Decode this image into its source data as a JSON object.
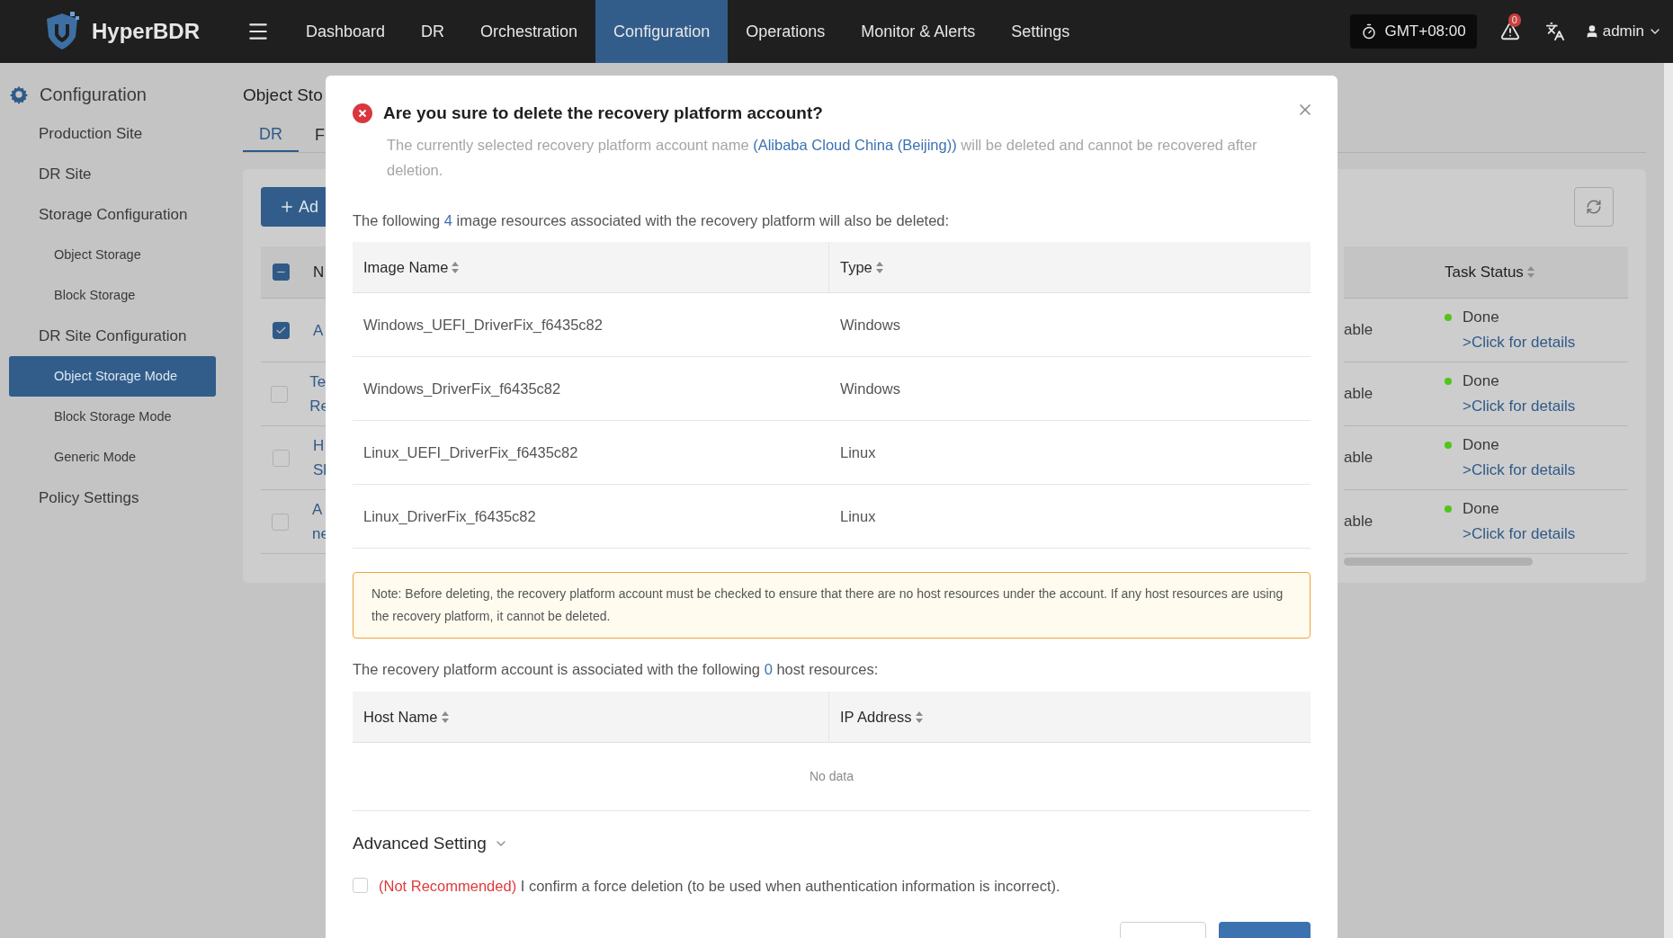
{
  "app": {
    "name": "HyperBDR"
  },
  "nav": [
    {
      "label": "Dashboard",
      "selected": false
    },
    {
      "label": "DR",
      "selected": false
    },
    {
      "label": "Orchestration",
      "selected": false
    },
    {
      "label": "Configuration",
      "selected": true
    },
    {
      "label": "Operations",
      "selected": false
    },
    {
      "label": "Monitor & Alerts",
      "selected": false
    },
    {
      "label": "Settings",
      "selected": false
    }
  ],
  "header": {
    "timezone": "GMT+08:00",
    "alert_count": "0",
    "user": "admin"
  },
  "sidebar": {
    "title": "Configuration",
    "items": [
      {
        "label": "Production Site",
        "selected": false
      },
      {
        "label": "DR Site",
        "selected": false
      },
      {
        "label": "Storage Configuration",
        "selected": false,
        "children": [
          {
            "label": "Object Storage",
            "selected": false
          },
          {
            "label": "Block Storage",
            "selected": false
          }
        ]
      },
      {
        "label": "DR Site Configuration",
        "selected": false,
        "children": [
          {
            "label": "Object Storage Mode",
            "selected": true
          },
          {
            "label": "Block Storage Mode",
            "selected": false
          },
          {
            "label": "Generic Mode",
            "selected": false
          }
        ]
      },
      {
        "label": "Policy Settings",
        "selected": false
      }
    ]
  },
  "page": {
    "title": "Object Sto",
    "tabs": [
      {
        "label": "DR",
        "selected": true
      },
      {
        "label": "F",
        "selected": false
      }
    ],
    "add_button": "Ad",
    "table": {
      "select_all_indeterminate": true,
      "columns": [
        "N",
        "Task Status"
      ],
      "rows": [
        {
          "checked": true,
          "name_lines": [
            "A"
          ],
          "column_cut": "able",
          "status": "Done",
          "color": "#52c41a",
          "details": ">Click for details"
        },
        {
          "checked": false,
          "name_lines": [
            "Te",
            "Re"
          ],
          "column_cut": "able",
          "status": "Done",
          "color": "#52c41a",
          "details": ">Click for details"
        },
        {
          "checked": false,
          "name_lines": [
            "H",
            "Sl"
          ],
          "column_cut": "able",
          "status": "Done",
          "color": "#52c41a",
          "details": ">Click for details"
        },
        {
          "checked": false,
          "name_lines": [
            "A",
            "ne"
          ],
          "column_cut": "able",
          "status": "Done",
          "color": "#52c41a",
          "details": ">Click for details"
        }
      ]
    }
  },
  "modal": {
    "title": "Are you sure to delete the recovery platform account?",
    "description_before": "The currently selected recovery platform account name ",
    "description_link": "(Alibaba Cloud China (Beijing))",
    "description_after": " will be deleted and cannot be recovered after deletion.",
    "images_before": "The following ",
    "images_count": "4",
    "images_after": " image resources associated with the recovery platform will also be deleted:",
    "image_columns": [
      "Image Name",
      "Type"
    ],
    "image_rows": [
      [
        "Windows_UEFI_DriverFix_f6435c82",
        "Windows"
      ],
      [
        "Windows_DriverFix_f6435c82",
        "Windows"
      ],
      [
        "Linux_UEFI_DriverFix_f6435c82",
        "Linux"
      ],
      [
        "Linux_DriverFix_f6435c82",
        "Linux"
      ]
    ],
    "note": "Note: Before deleting, the recovery platform account must be checked to ensure that there are no host resources under the account. If any host resources are using the recovery platform, it cannot be deleted.",
    "hosts_before": "The recovery platform account is associated with the following ",
    "hosts_count": "0",
    "hosts_after": " host resources:",
    "host_columns": [
      "Host Name",
      "IP Address"
    ],
    "host_empty": "No data",
    "advanced": "Advanced Setting",
    "force": {
      "checked": false,
      "warning": "(Not Recommended)",
      "text": "I confirm a force deletion (to be used when authentication information is incorrect)."
    }
  }
}
